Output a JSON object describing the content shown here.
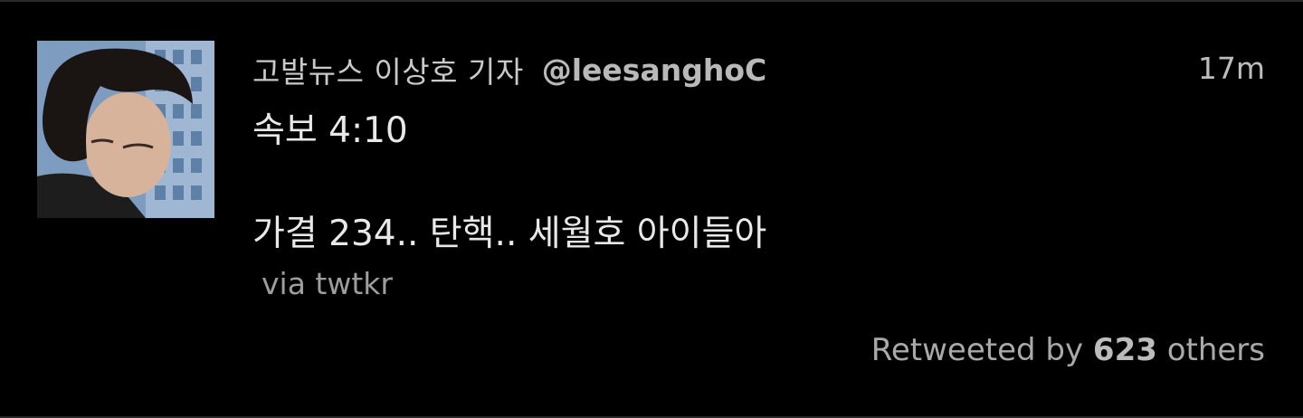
{
  "tweet": {
    "author": {
      "display_name": "고발뉴스 이상호 기자",
      "handle": "@leesanghoC",
      "avatar_icon": "user-avatar-photo"
    },
    "timestamp": "17m",
    "text_lines": [
      "속보 4:10",
      "가결 234.. 탄핵.. 세월호 아이들아"
    ],
    "source": "via twtkr",
    "retweet": {
      "prefix": "Retweeted by",
      "count": "623",
      "suffix": "others"
    }
  },
  "colors": {
    "background": "#000000",
    "primary_text": "#e8e8e8",
    "secondary_text": "#a9a9a9"
  }
}
